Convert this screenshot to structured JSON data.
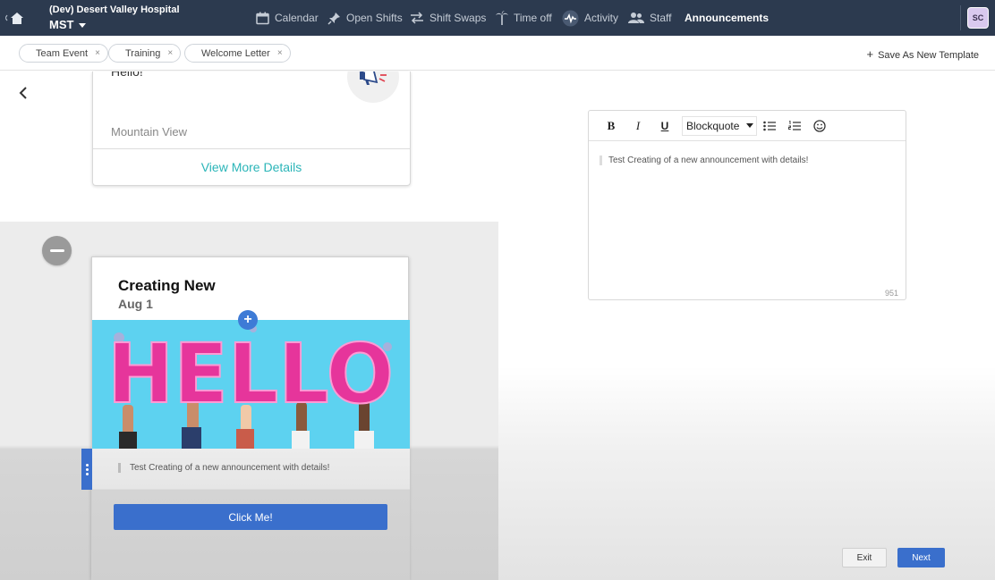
{
  "header": {
    "org_name": "(Dev) Desert Valley Hospital",
    "timezone": "MST",
    "nav": [
      {
        "label": "Calendar",
        "icon": "calendar-icon"
      },
      {
        "label": "Open Shifts",
        "icon": "pin-icon"
      },
      {
        "label": "Shift Swaps",
        "icon": "swap-icon"
      },
      {
        "label": "Time off",
        "icon": "palm-tree-icon"
      },
      {
        "label": "Activity",
        "icon": "activity-icon"
      },
      {
        "label": "Staff",
        "icon": "people-icon"
      },
      {
        "label": "Announcements",
        "icon": "",
        "active": true
      }
    ],
    "avatar_initials": "SC"
  },
  "templates": {
    "chips": [
      "Team Event",
      "Training",
      "Welcome Letter"
    ],
    "chip_remove_glyph": "×",
    "save_as_template": "Save As New Template"
  },
  "preview": {
    "card_top": {
      "greeting": "Hello!",
      "location": "Mountain View",
      "link": "View More Details"
    },
    "card_main": {
      "title": "Creating New",
      "date": "Aug 1",
      "image_text": "HELLO",
      "quote": "Test Creating of a new announcement with details!",
      "button_label": "Click Me!"
    }
  },
  "editor": {
    "block_style": "Blockquote",
    "content": "Test Creating of a new announcement with details!",
    "char_count": "951"
  },
  "actions": {
    "exit_label": "Exit",
    "next_label": "Next"
  },
  "colors": {
    "nav_bg": "#2c3a4f",
    "accent_blue": "#3a6fcc",
    "link_teal": "#2bb5b8",
    "image_bg": "#5dd2f0",
    "balloon_pink": "#e6359b"
  }
}
